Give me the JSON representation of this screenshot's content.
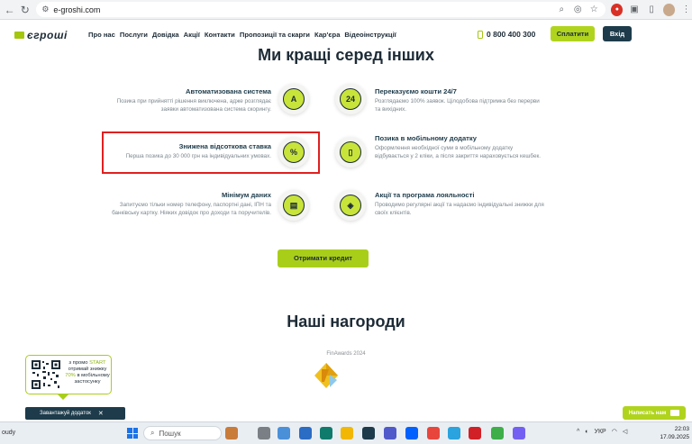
{
  "browser": {
    "url": "e-groshi.com",
    "icons": [
      "back-icon",
      "reload-icon",
      "site-info-icon",
      "zoom-icon",
      "eye-off-icon",
      "star-icon",
      "extension-icon",
      "puzzle-icon",
      "sidebar-icon",
      "profile-avatar",
      "menu-icon"
    ]
  },
  "header": {
    "logo": "єгроші",
    "nav": [
      "Про нас",
      "Послуги",
      "Довідка",
      "Акції",
      "Контакти",
      "Пропозиції та скарги",
      "Кар'єра",
      "Відеоінструкції"
    ],
    "phone": "0 800 400 300",
    "pay_button": "Сплатити",
    "login_button": "Вхід"
  },
  "benefits": {
    "title": "Ми кращі серед інших",
    "items": [
      {
        "title": "Автоматизована система",
        "desc": "Позика при прийнятті рішення виключена, адже розглядає заявки автоматизована система скорингу.",
        "icon": "a-letter-icon"
      },
      {
        "title": "Переказуємо кошти 24/7",
        "desc": "Розглядаємо 100% заявок. Цілодобова підтримка без перерви та вихідних.",
        "icon": "clock-24-icon",
        "icon_text": "24"
      },
      {
        "title": "Знижена відсоткова ставка",
        "desc": "Перша позика до 30 000 грн на індивідуальних умовах.",
        "icon": "percent-icon",
        "icon_text": "%"
      },
      {
        "title": "Позика в мобільному додатку",
        "desc": "Оформлення необхідної суми в мобільному додатку відбувається у 2 кліки, а після закриття нараховується кешбек.",
        "icon": "mobile-app-icon"
      },
      {
        "title": "Мінімум даних",
        "desc": "Запитуємо тільки номер телефону, паспортні дані, ІПН та банківську картку. Ніяких довідок про доходи та поручителів.",
        "icon": "passport-icon"
      },
      {
        "title": "Акції та програма лояльності",
        "desc": "Проводимо регулярні акції та надаємо індивідуальні знижки для своїх клієнтів.",
        "icon": "tag-icon"
      }
    ],
    "cta": "Отримати кредит"
  },
  "awards": {
    "title": "Наші нагороди",
    "label": "FinAwards 2024"
  },
  "promo": {
    "line1": "з промо",
    "code": "START",
    "line2": "отримай знижку",
    "percent": "70%",
    "line3": "в мобільному застосунку",
    "download": "Завантажуй додаток"
  },
  "chat_button": "Написать нам",
  "taskbar": {
    "left_text": "oudy",
    "search": "Пошук",
    "lang": "УКР",
    "time": "22:03",
    "date": "17.09.2025"
  },
  "colors": {
    "accent": "#a9ce1a",
    "dark": "#1d3b4a",
    "highlight": "#e02020"
  }
}
